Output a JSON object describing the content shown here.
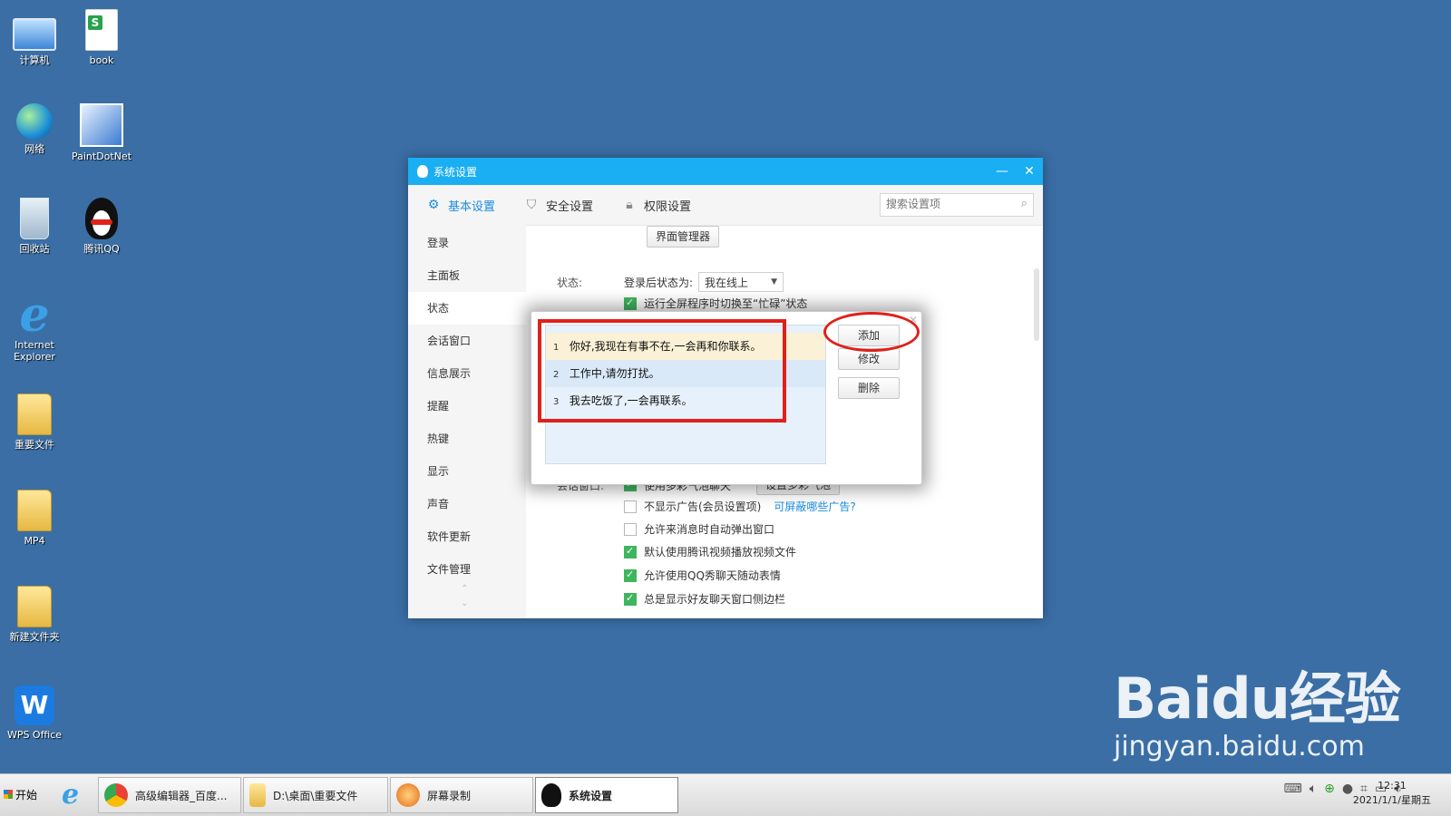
{
  "desktop": {
    "icons": [
      {
        "label": "计算机"
      },
      {
        "label": "book"
      },
      {
        "label": "网络"
      },
      {
        "label": "PaintDotNet"
      },
      {
        "label": "回收站"
      },
      {
        "label": "腾讯QQ"
      },
      {
        "label": "Internet\nExplorer"
      },
      {
        "label": "重要文件"
      },
      {
        "label": "MP4"
      },
      {
        "label": "新建文件夹"
      },
      {
        "label": "WPS Office"
      }
    ]
  },
  "window": {
    "title": "系统设置",
    "minimize": "—",
    "close": "✕",
    "tabs": [
      {
        "label": "基本设置",
        "icon": "gear-icon",
        "active": true
      },
      {
        "label": "安全设置",
        "icon": "shield-icon"
      },
      {
        "label": "权限设置",
        "icon": "lock-icon"
      }
    ],
    "search": {
      "placeholder": "搜索设置项"
    },
    "sidebar": [
      "登录",
      "主面板",
      "状态",
      "会话窗口",
      "信息展示",
      "提醒",
      "热键",
      "显示",
      "声音",
      "软件更新",
      "文件管理"
    ],
    "content": {
      "ui_manager_button": "界面管理器",
      "status_label": "状态:",
      "status_after_login_label": "登录后状态为:",
      "status_select_value": "我在线上",
      "status_partial_row": "运行全屏程序时切换至“忙碌”状态",
      "chat_label": "会话窗口:",
      "chat_options": [
        {
          "text": "使用多彩气泡聊天",
          "checked": true,
          "button": "设置多彩气泡"
        },
        {
          "text": "不显示广告(会员设置项)",
          "checked": false,
          "link": "可屏蔽哪些广告?"
        },
        {
          "text": "允许来消息时自动弹出窗口",
          "checked": false
        },
        {
          "text": "默认使用腾讯视频播放视频文件",
          "checked": true
        },
        {
          "text": "允许使用QQ秀聊天随动表情",
          "checked": true
        },
        {
          "text": "总是显示好友聊天窗口侧边栏",
          "checked": true
        }
      ]
    }
  },
  "dialog": {
    "close": "✕",
    "messages": [
      {
        "num": "1",
        "text": "你好,我现在有事不在,一会再和你联系。"
      },
      {
        "num": "2",
        "text": "工作中,请勿打扰。"
      },
      {
        "num": "3",
        "text": "我去吃饭了,一会再联系。"
      }
    ],
    "buttons": {
      "add": "添加",
      "edit": "修改",
      "delete": "删除"
    }
  },
  "taskbar": {
    "start": "开始",
    "items": [
      {
        "label": "高级编辑器_百度..."
      },
      {
        "label": "D:\\桌面\\重要文件"
      },
      {
        "label": "屏幕录制"
      },
      {
        "label": "系统设置",
        "active": true
      }
    ],
    "time": "12:31",
    "date": "2021/1/1/星期五"
  },
  "watermark": {
    "brand": "Baidu经验",
    "url": "jingyan.baidu.com"
  }
}
